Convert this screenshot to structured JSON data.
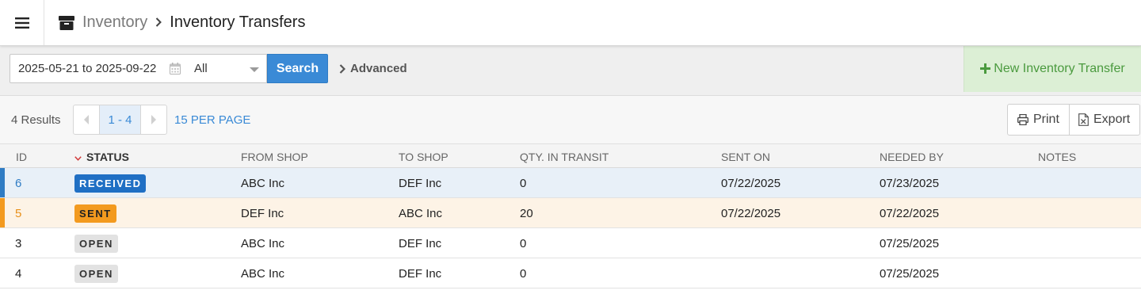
{
  "header": {
    "breadcrumb_root": "Inventory",
    "breadcrumb_sep": ">",
    "breadcrumb_current": "Inventory Transfers"
  },
  "filter": {
    "date_range": "2025-05-21 to 2025-09-22",
    "status_select": "All",
    "search_label": "Search",
    "advanced_label": "Advanced",
    "new_button_label": "New Inventory Transfer"
  },
  "results": {
    "count_label": "4 Results",
    "page_range": "1 - 4",
    "per_page_label": "15 PER PAGE",
    "print_label": "Print",
    "export_label": "Export"
  },
  "table": {
    "columns": [
      "ID",
      "STATUS",
      "FROM SHOP",
      "TO SHOP",
      "QTY. IN TRANSIT",
      "SENT ON",
      "NEEDED BY",
      "NOTES"
    ],
    "rows": [
      {
        "id": "6",
        "status": "RECEIVED",
        "from": "ABC Inc",
        "to": "DEF Inc",
        "qty": "0",
        "sent_on": "07/22/2025",
        "needed_by": "07/23/2025",
        "notes": ""
      },
      {
        "id": "5",
        "status": "SENT",
        "from": "DEF Inc",
        "to": "ABC Inc",
        "qty": "20",
        "sent_on": "07/22/2025",
        "needed_by": "07/22/2025",
        "notes": ""
      },
      {
        "id": "3",
        "status": "OPEN",
        "from": "ABC Inc",
        "to": "DEF Inc",
        "qty": "0",
        "sent_on": "",
        "needed_by": "07/25/2025",
        "notes": ""
      },
      {
        "id": "4",
        "status": "OPEN",
        "from": "ABC Inc",
        "to": "DEF Inc",
        "qty": "0",
        "sent_on": "",
        "needed_by": "07/25/2025",
        "notes": ""
      }
    ]
  },
  "colors": {
    "accent_blue": "#3a8ad6",
    "received": "#1f6fc4",
    "sent": "#f39a1f",
    "open": "#e2e2e2",
    "new_button_bg": "#dcefd5",
    "new_button_text": "#4a9a3e"
  },
  "icons": [
    "hamburger-menu-icon",
    "archive-box-icon",
    "chevron-right-icon",
    "calendar-icon",
    "caret-down-icon",
    "plus-icon",
    "chevron-left-icon",
    "printer-icon",
    "excel-file-icon",
    "sort-down-icon"
  ]
}
